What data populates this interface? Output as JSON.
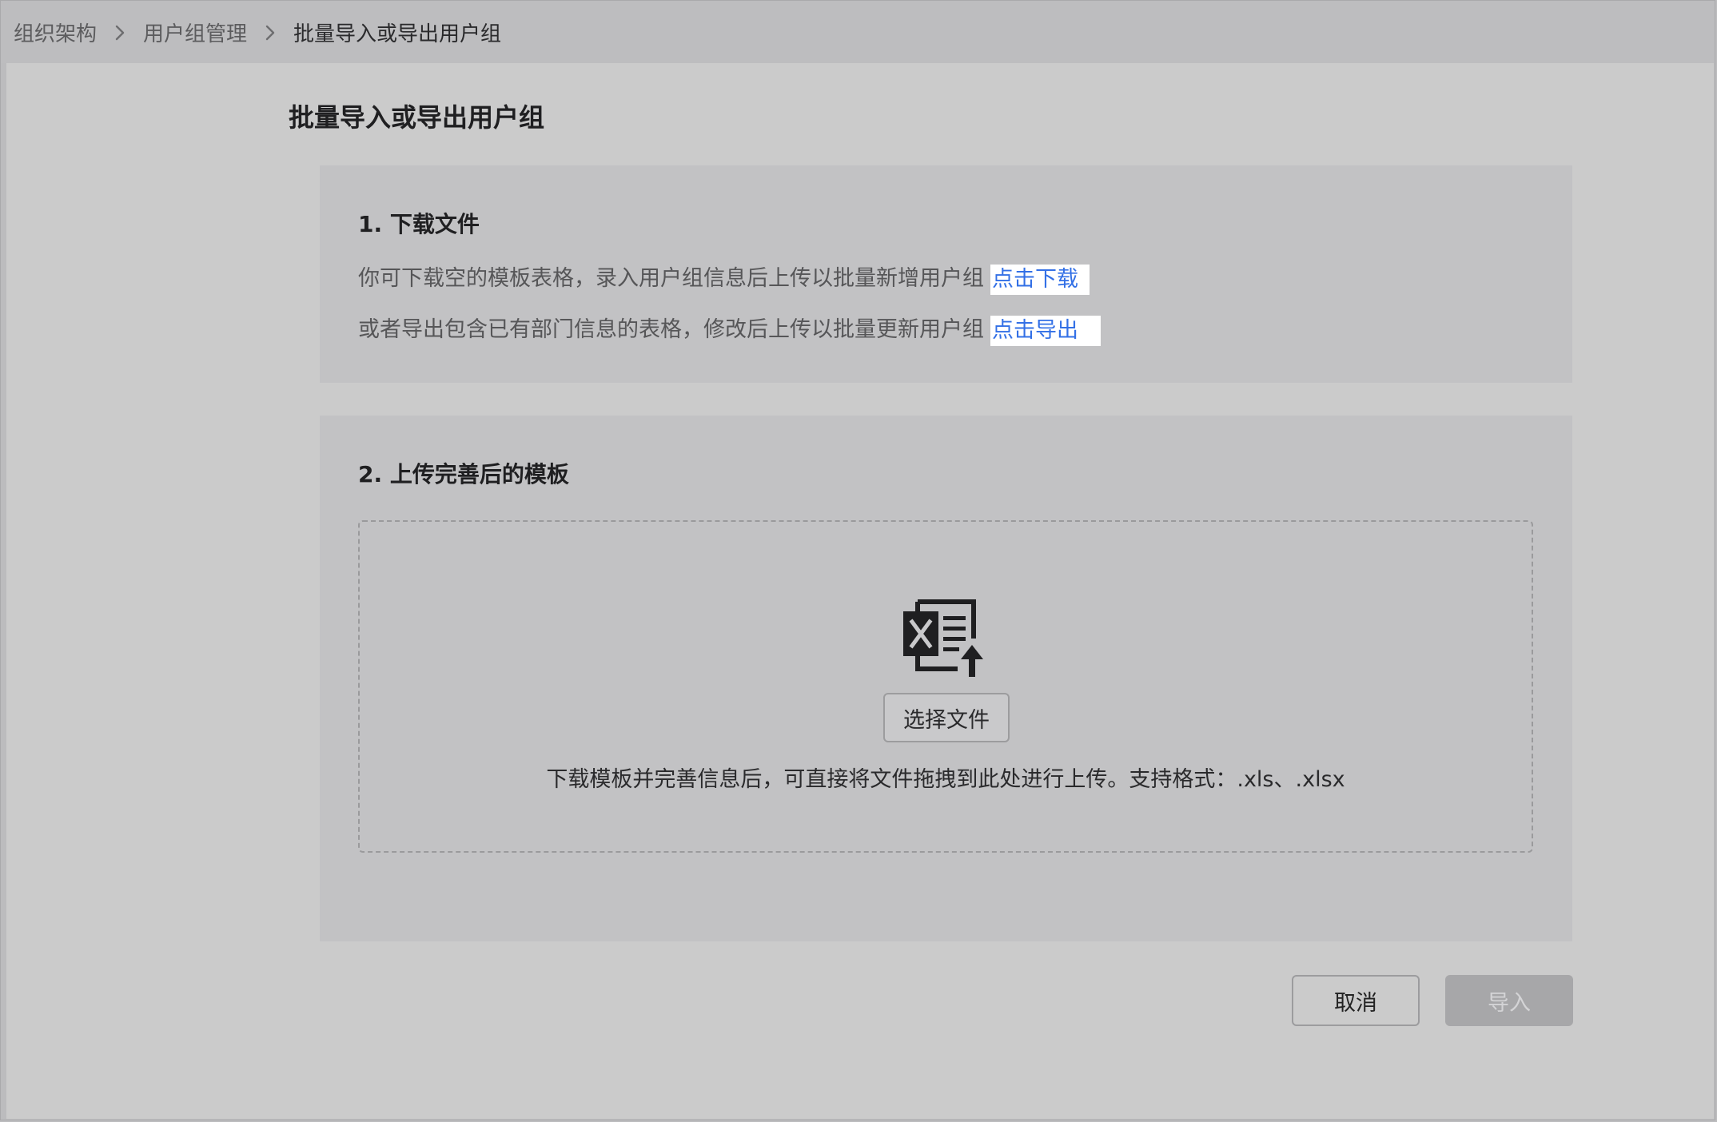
{
  "breadcrumb": {
    "items": [
      "组织架构",
      "用户组管理",
      "批量导入或导出用户组"
    ]
  },
  "page": {
    "title": "批量导入或导出用户组"
  },
  "step1": {
    "heading": "1. 下载文件",
    "line1_text": "你可下载空的模板表格，录入用户组信息后上传以批量新增用户组",
    "line1_link": "点击下载",
    "line2_text": "或者导出包含已有部门信息的表格，修改后上传以批量更新用户组",
    "line2_link": "点击导出"
  },
  "step2": {
    "heading": "2. 上传完善后的模板",
    "select_file_label": "选择文件",
    "hint": "下载模板并完善信息后，可直接将文件拖拽到此处进行上传。支持格式：.xls、.xlsx"
  },
  "footer": {
    "cancel_label": "取消",
    "import_label": "导入"
  },
  "colors": {
    "link": "#3370e6",
    "icon": "#1f1f21",
    "disabled_button": "#a7a7a9"
  },
  "icons": {
    "breadcrumb_separator": "chevron-right-icon",
    "upload": "excel-upload-icon"
  }
}
